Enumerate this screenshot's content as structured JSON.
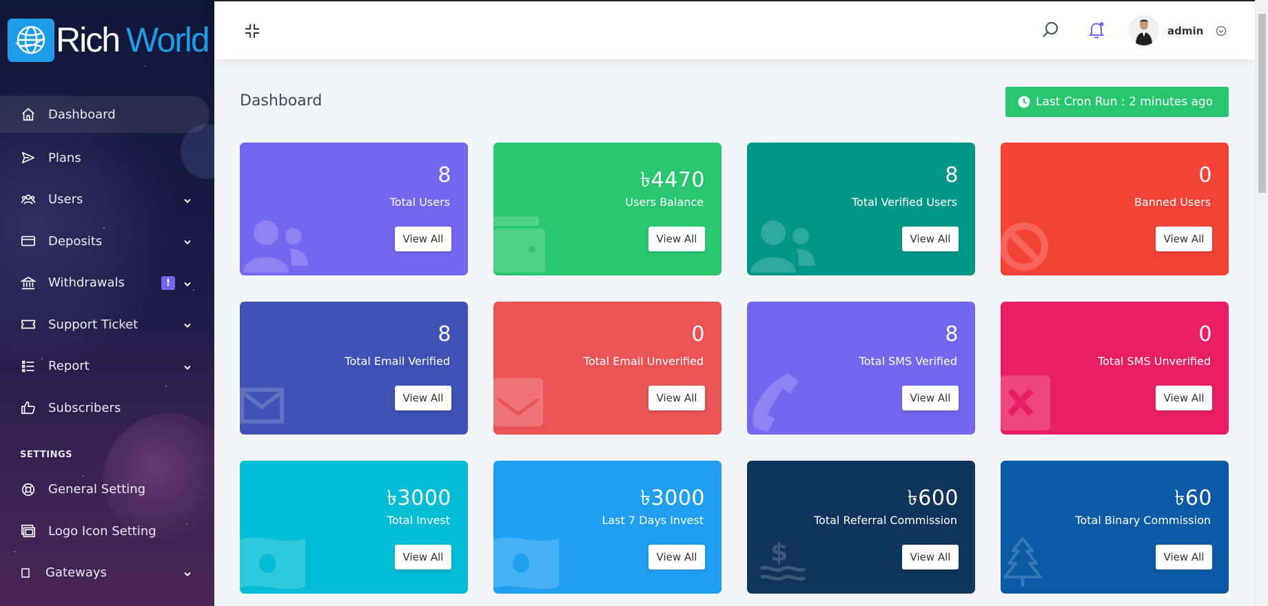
{
  "brand": {
    "name_part1": "Rich",
    "name_part2": "World"
  },
  "sidebar": {
    "items": [
      {
        "label": "Dashboard",
        "icon": "home-icon",
        "active": true
      },
      {
        "label": "Plans",
        "icon": "send-icon"
      },
      {
        "label": "Users",
        "icon": "users-icon",
        "expandable": true
      },
      {
        "label": "Deposits",
        "icon": "credit-card-icon",
        "expandable": true
      },
      {
        "label": "Withdrawals",
        "icon": "bank-icon",
        "expandable": true,
        "badge": "!"
      },
      {
        "label": "Support Ticket",
        "icon": "ticket-icon",
        "expandable": true
      },
      {
        "label": "Report",
        "icon": "list-icon",
        "expandable": true
      },
      {
        "label": "Subscribers",
        "icon": "thumbs-up-icon"
      }
    ],
    "settings_heading": "SETTINGS",
    "settings_items": [
      {
        "label": "General Setting",
        "icon": "life-ring-icon"
      },
      {
        "label": "Logo Icon Setting",
        "icon": "images-icon"
      },
      {
        "label": "Gateways",
        "icon": "square-icon",
        "expandable": true
      }
    ]
  },
  "header": {
    "username": "admin",
    "icons": [
      "compress-icon",
      "search-icon",
      "bell-icon",
      "chevron-down-icon"
    ]
  },
  "page": {
    "title": "Dashboard",
    "cron_text": "Last Cron Run : 2 minutes ago"
  },
  "cards": [
    {
      "amount": "8",
      "label": "Total Users",
      "button": "View All",
      "color": "#7367f0",
      "icon": "users-icon"
    },
    {
      "amount": "৳4470",
      "label": "Users Balance",
      "button": "View All",
      "color": "#28c76f",
      "icon": "wallet-icon"
    },
    {
      "amount": "8",
      "label": "Total Verified Users",
      "button": "View All",
      "color": "#009688",
      "icon": "users-icon"
    },
    {
      "amount": "0",
      "label": "Banned Users",
      "button": "View All",
      "color": "#f44336",
      "icon": "ban-icon"
    },
    {
      "amount": "8",
      "label": "Total Email Verified",
      "button": "View All",
      "color": "#3f51b5",
      "icon": "envelope-icon"
    },
    {
      "amount": "0",
      "label": "Total Email Unverified",
      "button": "View All",
      "color": "#ea5455",
      "icon": "envelope-open-icon"
    },
    {
      "amount": "8",
      "label": "Total SMS Verified",
      "button": "View All",
      "color": "#7367f0",
      "icon": "phone-icon"
    },
    {
      "amount": "0",
      "label": "Total SMS Unverified",
      "button": "View All",
      "color": "#e91e63",
      "icon": "times-icon"
    },
    {
      "amount": "৳3000",
      "label": "Total Invest",
      "button": "View All",
      "color": "#00bcd4",
      "icon": "money-icon"
    },
    {
      "amount": "৳3000",
      "label": "Last 7 Days Invest",
      "button": "View All",
      "color": "#1e9ff2",
      "icon": "money-icon"
    },
    {
      "amount": "৳600",
      "label": "Total Referral Commission",
      "button": "View All",
      "color": "#10345b",
      "icon": "dollar-wave-icon"
    },
    {
      "amount": "৳60",
      "label": "Total Binary Commission",
      "button": "View All",
      "color": "#0b5aa5",
      "icon": "tree-icon"
    }
  ]
}
